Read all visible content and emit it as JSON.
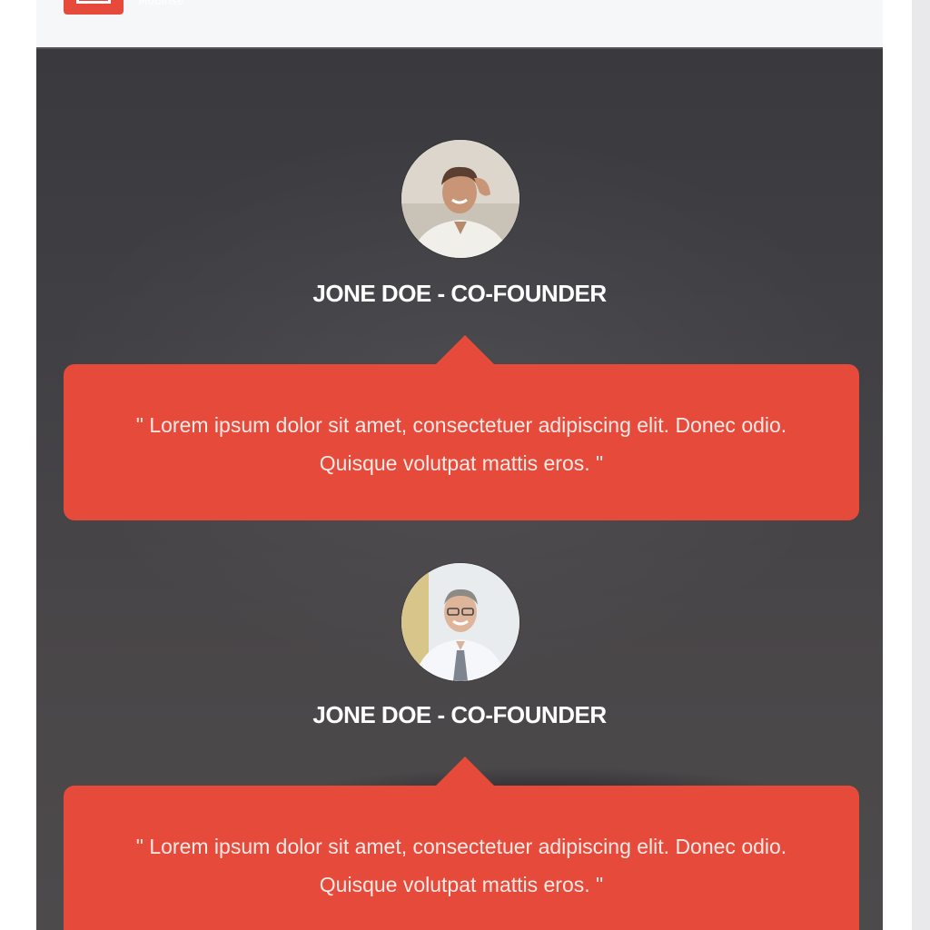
{
  "header": {
    "logo_icon": "logo-icon",
    "logo_text": "Mobirise"
  },
  "testimonials": [
    {
      "name": "JONE DOE - CO-FOUNDER",
      "avatar": "avatar-man-casual",
      "quote": "\" Lorem ipsum dolor sit amet, consectetuer adipiscing elit. Donec odio. Quisque volutpat mattis eros. \""
    },
    {
      "name": "JONE DOE - CO-FOUNDER",
      "avatar": "avatar-man-tie",
      "quote": "\" Lorem ipsum dolor sit amet, consectetuer adipiscing elit. Donec odio. Quisque volutpat mattis eros. \""
    }
  ],
  "colors": {
    "accent": "#e64a3b",
    "section_bg": "#414044",
    "header_bg": "#f6f7f9",
    "text_light": "#ffffff"
  }
}
